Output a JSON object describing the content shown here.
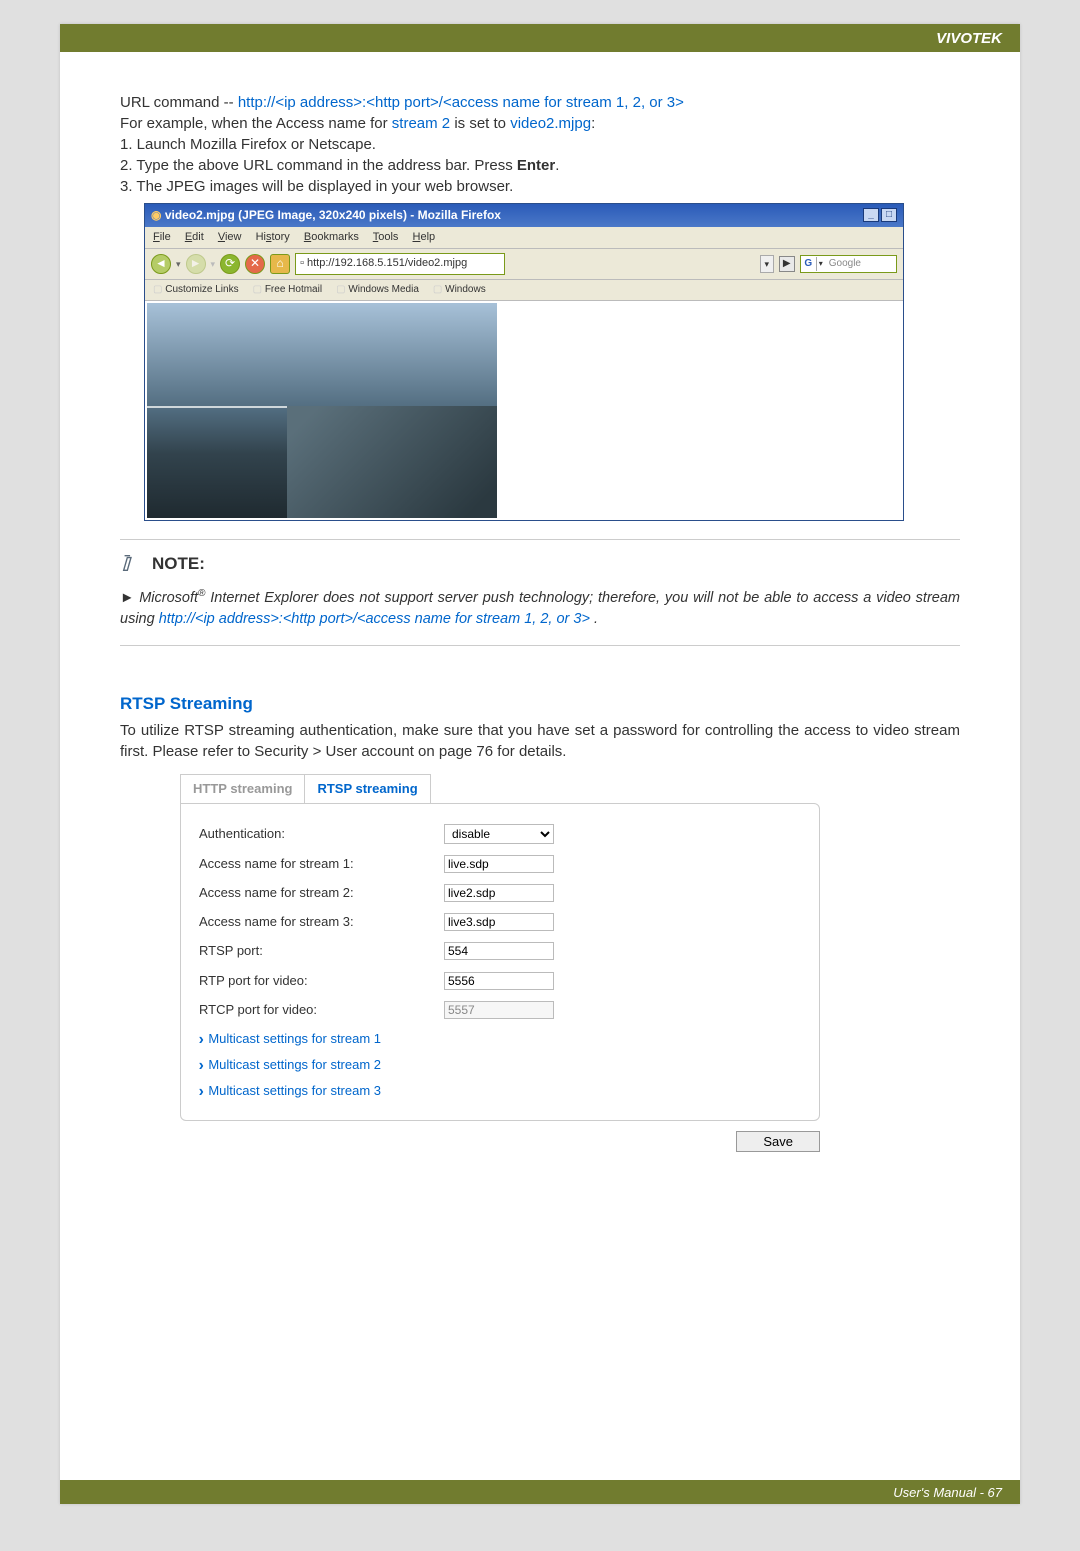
{
  "header": {
    "brand": "VIVOTEK"
  },
  "urlcmd": {
    "prefix": "URL command -- ",
    "url": "http://<ip address>:<http port>/<access name for stream 1, 2, or 3>",
    "eg_a": "For example, when the Access name for ",
    "eg_stream": "stream 2",
    "eg_b": " is set to ",
    "eg_name": "video2.mjpg",
    "eg_c": ":",
    "step1": "1. Launch Mozilla Firefox or Netscape.",
    "step2a": "2. Type the above URL command in the address bar. Press ",
    "step2b": "Enter",
    "step2c": ".",
    "step3": "3. The JPEG images will be displayed in your web browser."
  },
  "firefox": {
    "title": "video2.mjpg (JPEG Image, 320x240 pixels) - Mozilla Firefox",
    "menu": [
      "File",
      "Edit",
      "View",
      "History",
      "Bookmarks",
      "Tools",
      "Help"
    ],
    "url": "http://192.168.5.151/video2.mjpg",
    "search_provider": "G",
    "search_placeholder": "Google",
    "bookmarks": [
      "Customize Links",
      "Free Hotmail",
      "Windows Media",
      "Windows"
    ]
  },
  "note": {
    "heading": "NOTE:",
    "arrow": "►",
    "text_a": "Microsoft",
    "text_reg": "®",
    "text_b": " Internet Explorer does not support server push technology; therefore, you will not be able to access a video stream using ",
    "text_url": "http://<ip address>:<http port>/<access name for stream 1, 2, or 3>",
    "text_c": " ."
  },
  "rtsp": {
    "heading": "RTSP Streaming",
    "para": "To utilize RTSP streaming authentication, make sure that you have set a password for controlling the access to video stream first. Please refer to Security > User account on page 76 for details.",
    "tabs": {
      "http": "HTTP streaming",
      "rtsp": "RTSP streaming"
    },
    "fields": {
      "auth_label": "Authentication:",
      "auth_value": "disable",
      "s1_label": "Access name for stream 1:",
      "s1_value": "live.sdp",
      "s2_label": "Access name for stream 2:",
      "s2_value": "live2.sdp",
      "s3_label": "Access name for stream 3:",
      "s3_value": "live3.sdp",
      "rtsp_port_label": "RTSP port:",
      "rtsp_port_value": "554",
      "rtp_port_label": "RTP port for video:",
      "rtp_port_value": "5556",
      "rtcp_port_label": "RTCP port for video:",
      "rtcp_port_value": "5557"
    },
    "expand": {
      "m1": "Multicast settings for stream 1",
      "m2": "Multicast settings for stream 2",
      "m3": "Multicast settings for stream 3"
    },
    "save": "Save"
  },
  "footer": {
    "text": "User's Manual - 67"
  }
}
